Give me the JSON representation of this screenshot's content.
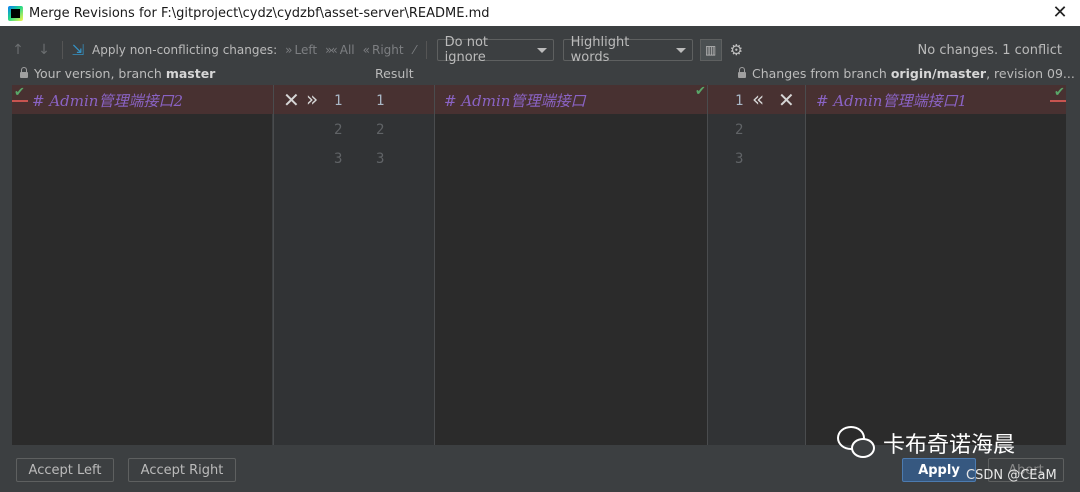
{
  "window": {
    "title": "Merge Revisions for F:\\gitproject\\cydz\\cydzbf\\asset-server\\README.md"
  },
  "toolbar": {
    "apply_label": "Apply non-conflicting changes:",
    "left": "Left",
    "all": "All",
    "right": "Right",
    "ignore_combo": "Do not ignore",
    "highlight_combo": "Highlight words",
    "status": "No changes. 1 conflict"
  },
  "headers": {
    "left_prefix": "Your version, branch ",
    "left_branch": "master",
    "center": "Result",
    "right_prefix": "Changes from branch ",
    "right_branch": "origin/master",
    "right_suffix": ", revision 09..."
  },
  "editors": {
    "left_line": "# Admin管理端接口2",
    "center_line": "# Admin管理端接口",
    "right_line": "# Admin管理端接口1",
    "left_gutter_nums": [
      "1",
      "2",
      "3"
    ],
    "center_gutter_nums": [
      "1",
      "2",
      "3"
    ],
    "right_gutter_nums": [
      "1",
      "2",
      "3"
    ]
  },
  "buttons": {
    "accept_left": "Accept Left",
    "accept_right": "Accept Right",
    "apply": "Apply",
    "abort": "Abort"
  },
  "watermark": {
    "brand": "卡布奇诺海晨",
    "csdn": "CSDN @CEaM"
  },
  "colors": {
    "conflict": "#483131",
    "accent": "#365880",
    "keyword_italic": "#8a63c4"
  }
}
